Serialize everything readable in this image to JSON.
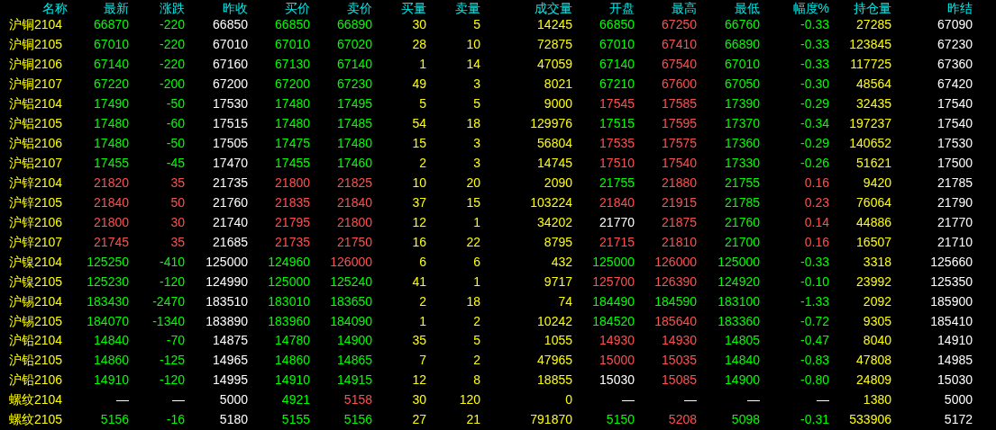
{
  "table": {
    "columns": [
      "名称",
      "最新",
      "涨跌",
      "昨收",
      "买价",
      "卖价",
      "买量",
      "卖量",
      "成交量",
      "开盘",
      "最高",
      "最低",
      "幅度%",
      "持仓量",
      "昨结"
    ],
    "rows": [
      {
        "cells": [
          {
            "text": "沪铜2104",
            "color": "#ffff00"
          },
          {
            "text": "66870",
            "color": "#00ff00"
          },
          {
            "text": "-220",
            "color": "#00ff00"
          },
          {
            "text": "66850",
            "color": "#ffffff"
          },
          {
            "text": "66850",
            "color": "#00ff00"
          },
          {
            "text": "66890",
            "color": "#00ff00"
          },
          {
            "text": "30",
            "color": "#ffff00"
          },
          {
            "text": "5",
            "color": "#ffff00"
          },
          {
            "text": "14245",
            "color": "#ffff00"
          },
          {
            "text": "66850",
            "color": "#00ff00"
          },
          {
            "text": "67250",
            "color": "#ff5050"
          },
          {
            "text": "66760",
            "color": "#00ff00"
          },
          {
            "text": "-0.33",
            "color": "#00ff00"
          },
          {
            "text": "27285",
            "color": "#ffff00"
          },
          {
            "text": "67090",
            "color": "#ffffff"
          }
        ]
      },
      {
        "cells": [
          {
            "text": "沪铜2105",
            "color": "#ffff00"
          },
          {
            "text": "67010",
            "color": "#00ff00"
          },
          {
            "text": "-220",
            "color": "#00ff00"
          },
          {
            "text": "67010",
            "color": "#ffffff"
          },
          {
            "text": "67010",
            "color": "#00ff00"
          },
          {
            "text": "67020",
            "color": "#00ff00"
          },
          {
            "text": "28",
            "color": "#ffff00"
          },
          {
            "text": "10",
            "color": "#ffff00"
          },
          {
            "text": "72875",
            "color": "#ffff00"
          },
          {
            "text": "67010",
            "color": "#00ff00"
          },
          {
            "text": "67410",
            "color": "#ff5050"
          },
          {
            "text": "66890",
            "color": "#00ff00"
          },
          {
            "text": "-0.33",
            "color": "#00ff00"
          },
          {
            "text": "123845",
            "color": "#ffff00"
          },
          {
            "text": "67230",
            "color": "#ffffff"
          }
        ]
      },
      {
        "cells": [
          {
            "text": "沪铜2106",
            "color": "#ffff00"
          },
          {
            "text": "67140",
            "color": "#00ff00"
          },
          {
            "text": "-220",
            "color": "#00ff00"
          },
          {
            "text": "67160",
            "color": "#ffffff"
          },
          {
            "text": "67130",
            "color": "#00ff00"
          },
          {
            "text": "67140",
            "color": "#00ff00"
          },
          {
            "text": "1",
            "color": "#ffff00"
          },
          {
            "text": "14",
            "color": "#ffff00"
          },
          {
            "text": "47059",
            "color": "#ffff00"
          },
          {
            "text": "67140",
            "color": "#00ff00"
          },
          {
            "text": "67540",
            "color": "#ff5050"
          },
          {
            "text": "67010",
            "color": "#00ff00"
          },
          {
            "text": "-0.33",
            "color": "#00ff00"
          },
          {
            "text": "117725",
            "color": "#ffff00"
          },
          {
            "text": "67360",
            "color": "#ffffff"
          }
        ]
      },
      {
        "cells": [
          {
            "text": "沪铜2107",
            "color": "#ffff00"
          },
          {
            "text": "67220",
            "color": "#00ff00"
          },
          {
            "text": "-200",
            "color": "#00ff00"
          },
          {
            "text": "67200",
            "color": "#ffffff"
          },
          {
            "text": "67200",
            "color": "#00ff00"
          },
          {
            "text": "67230",
            "color": "#00ff00"
          },
          {
            "text": "49",
            "color": "#ffff00"
          },
          {
            "text": "3",
            "color": "#ffff00"
          },
          {
            "text": "8021",
            "color": "#ffff00"
          },
          {
            "text": "67210",
            "color": "#00ff00"
          },
          {
            "text": "67600",
            "color": "#ff5050"
          },
          {
            "text": "67050",
            "color": "#00ff00"
          },
          {
            "text": "-0.30",
            "color": "#00ff00"
          },
          {
            "text": "48564",
            "color": "#ffff00"
          },
          {
            "text": "67420",
            "color": "#ffffff"
          }
        ]
      },
      {
        "cells": [
          {
            "text": "沪铝2104",
            "color": "#ffff00"
          },
          {
            "text": "17490",
            "color": "#00ff00"
          },
          {
            "text": "-50",
            "color": "#00ff00"
          },
          {
            "text": "17530",
            "color": "#ffffff"
          },
          {
            "text": "17480",
            "color": "#00ff00"
          },
          {
            "text": "17495",
            "color": "#00ff00"
          },
          {
            "text": "5",
            "color": "#ffff00"
          },
          {
            "text": "5",
            "color": "#ffff00"
          },
          {
            "text": "9000",
            "color": "#ffff00"
          },
          {
            "text": "17545",
            "color": "#ff5050"
          },
          {
            "text": "17585",
            "color": "#ff5050"
          },
          {
            "text": "17390",
            "color": "#00ff00"
          },
          {
            "text": "-0.29",
            "color": "#00ff00"
          },
          {
            "text": "32435",
            "color": "#ffff00"
          },
          {
            "text": "17540",
            "color": "#ffffff"
          }
        ]
      },
      {
        "cells": [
          {
            "text": "沪铝2105",
            "color": "#ffff00"
          },
          {
            "text": "17480",
            "color": "#00ff00"
          },
          {
            "text": "-60",
            "color": "#00ff00"
          },
          {
            "text": "17515",
            "color": "#ffffff"
          },
          {
            "text": "17480",
            "color": "#00ff00"
          },
          {
            "text": "17485",
            "color": "#00ff00"
          },
          {
            "text": "54",
            "color": "#ffff00"
          },
          {
            "text": "18",
            "color": "#ffff00"
          },
          {
            "text": "129976",
            "color": "#ffff00"
          },
          {
            "text": "17515",
            "color": "#00ff00"
          },
          {
            "text": "17595",
            "color": "#ff5050"
          },
          {
            "text": "17370",
            "color": "#00ff00"
          },
          {
            "text": "-0.34",
            "color": "#00ff00"
          },
          {
            "text": "197237",
            "color": "#ffff00"
          },
          {
            "text": "17540",
            "color": "#ffffff"
          }
        ]
      },
      {
        "cells": [
          {
            "text": "沪铝2106",
            "color": "#ffff00"
          },
          {
            "text": "17480",
            "color": "#00ff00"
          },
          {
            "text": "-50",
            "color": "#00ff00"
          },
          {
            "text": "17505",
            "color": "#ffffff"
          },
          {
            "text": "17475",
            "color": "#00ff00"
          },
          {
            "text": "17480",
            "color": "#00ff00"
          },
          {
            "text": "15",
            "color": "#ffff00"
          },
          {
            "text": "3",
            "color": "#ffff00"
          },
          {
            "text": "56804",
            "color": "#ffff00"
          },
          {
            "text": "17535",
            "color": "#ff5050"
          },
          {
            "text": "17575",
            "color": "#ff5050"
          },
          {
            "text": "17360",
            "color": "#00ff00"
          },
          {
            "text": "-0.29",
            "color": "#00ff00"
          },
          {
            "text": "140652",
            "color": "#ffff00"
          },
          {
            "text": "17530",
            "color": "#ffffff"
          }
        ]
      },
      {
        "cells": [
          {
            "text": "沪铝2107",
            "color": "#ffff00"
          },
          {
            "text": "17455",
            "color": "#00ff00"
          },
          {
            "text": "-45",
            "color": "#00ff00"
          },
          {
            "text": "17470",
            "color": "#ffffff"
          },
          {
            "text": "17455",
            "color": "#00ff00"
          },
          {
            "text": "17460",
            "color": "#00ff00"
          },
          {
            "text": "2",
            "color": "#ffff00"
          },
          {
            "text": "3",
            "color": "#ffff00"
          },
          {
            "text": "14745",
            "color": "#ffff00"
          },
          {
            "text": "17510",
            "color": "#ff5050"
          },
          {
            "text": "17540",
            "color": "#ff5050"
          },
          {
            "text": "17330",
            "color": "#00ff00"
          },
          {
            "text": "-0.26",
            "color": "#00ff00"
          },
          {
            "text": "51621",
            "color": "#ffff00"
          },
          {
            "text": "17500",
            "color": "#ffffff"
          }
        ]
      },
      {
        "cells": [
          {
            "text": "沪锌2104",
            "color": "#ffff00"
          },
          {
            "text": "21820",
            "color": "#ff5050"
          },
          {
            "text": "35",
            "color": "#ff5050"
          },
          {
            "text": "21735",
            "color": "#ffffff"
          },
          {
            "text": "21800",
            "color": "#ff5050"
          },
          {
            "text": "21825",
            "color": "#ff5050"
          },
          {
            "text": "10",
            "color": "#ffff00"
          },
          {
            "text": "20",
            "color": "#ffff00"
          },
          {
            "text": "2090",
            "color": "#ffff00"
          },
          {
            "text": "21755",
            "color": "#00ff00"
          },
          {
            "text": "21880",
            "color": "#ff5050"
          },
          {
            "text": "21755",
            "color": "#00ff00"
          },
          {
            "text": "0.16",
            "color": "#ff5050"
          },
          {
            "text": "9420",
            "color": "#ffff00"
          },
          {
            "text": "21785",
            "color": "#ffffff"
          }
        ]
      },
      {
        "cells": [
          {
            "text": "沪锌2105",
            "color": "#ffff00"
          },
          {
            "text": "21840",
            "color": "#ff5050"
          },
          {
            "text": "50",
            "color": "#ff5050"
          },
          {
            "text": "21760",
            "color": "#ffffff"
          },
          {
            "text": "21835",
            "color": "#ff5050"
          },
          {
            "text": "21840",
            "color": "#ff5050"
          },
          {
            "text": "37",
            "color": "#ffff00"
          },
          {
            "text": "15",
            "color": "#ffff00"
          },
          {
            "text": "103224",
            "color": "#ffff00"
          },
          {
            "text": "21840",
            "color": "#ff5050"
          },
          {
            "text": "21915",
            "color": "#ff5050"
          },
          {
            "text": "21785",
            "color": "#00ff00"
          },
          {
            "text": "0.23",
            "color": "#ff5050"
          },
          {
            "text": "76064",
            "color": "#ffff00"
          },
          {
            "text": "21790",
            "color": "#ffffff"
          }
        ]
      },
      {
        "cells": [
          {
            "text": "沪锌2106",
            "color": "#ffff00"
          },
          {
            "text": "21800",
            "color": "#ff5050"
          },
          {
            "text": "30",
            "color": "#ff5050"
          },
          {
            "text": "21740",
            "color": "#ffffff"
          },
          {
            "text": "21795",
            "color": "#ff5050"
          },
          {
            "text": "21800",
            "color": "#ff5050"
          },
          {
            "text": "12",
            "color": "#ffff00"
          },
          {
            "text": "1",
            "color": "#ffff00"
          },
          {
            "text": "34202",
            "color": "#ffff00"
          },
          {
            "text": "21770",
            "color": "#ffffff"
          },
          {
            "text": "21875",
            "color": "#ff5050"
          },
          {
            "text": "21760",
            "color": "#00ff00"
          },
          {
            "text": "0.14",
            "color": "#ff5050"
          },
          {
            "text": "44886",
            "color": "#ffff00"
          },
          {
            "text": "21770",
            "color": "#ffffff"
          }
        ]
      },
      {
        "cells": [
          {
            "text": "沪锌2107",
            "color": "#ffff00"
          },
          {
            "text": "21745",
            "color": "#ff5050"
          },
          {
            "text": "35",
            "color": "#ff5050"
          },
          {
            "text": "21685",
            "color": "#ffffff"
          },
          {
            "text": "21735",
            "color": "#ff5050"
          },
          {
            "text": "21750",
            "color": "#ff5050"
          },
          {
            "text": "16",
            "color": "#ffff00"
          },
          {
            "text": "22",
            "color": "#ffff00"
          },
          {
            "text": "8795",
            "color": "#ffff00"
          },
          {
            "text": "21715",
            "color": "#ff5050"
          },
          {
            "text": "21810",
            "color": "#ff5050"
          },
          {
            "text": "21700",
            "color": "#00ff00"
          },
          {
            "text": "0.16",
            "color": "#ff5050"
          },
          {
            "text": "16507",
            "color": "#ffff00"
          },
          {
            "text": "21710",
            "color": "#ffffff"
          }
        ]
      },
      {
        "cells": [
          {
            "text": "沪镍2104",
            "color": "#ffff00"
          },
          {
            "text": "125250",
            "color": "#00ff00"
          },
          {
            "text": "-410",
            "color": "#00ff00"
          },
          {
            "text": "125000",
            "color": "#ffffff"
          },
          {
            "text": "124960",
            "color": "#00ff00"
          },
          {
            "text": "126000",
            "color": "#ff5050"
          },
          {
            "text": "6",
            "color": "#ffff00"
          },
          {
            "text": "6",
            "color": "#ffff00"
          },
          {
            "text": "432",
            "color": "#ffff00"
          },
          {
            "text": "125000",
            "color": "#00ff00"
          },
          {
            "text": "126000",
            "color": "#ff5050"
          },
          {
            "text": "125000",
            "color": "#00ff00"
          },
          {
            "text": "-0.33",
            "color": "#00ff00"
          },
          {
            "text": "3318",
            "color": "#ffff00"
          },
          {
            "text": "125660",
            "color": "#ffffff"
          }
        ]
      },
      {
        "cells": [
          {
            "text": "沪镍2105",
            "color": "#ffff00"
          },
          {
            "text": "125230",
            "color": "#00ff00"
          },
          {
            "text": "-120",
            "color": "#00ff00"
          },
          {
            "text": "124990",
            "color": "#ffffff"
          },
          {
            "text": "125000",
            "color": "#00ff00"
          },
          {
            "text": "125240",
            "color": "#00ff00"
          },
          {
            "text": "41",
            "color": "#ffff00"
          },
          {
            "text": "1",
            "color": "#ffff00"
          },
          {
            "text": "9717",
            "color": "#ffff00"
          },
          {
            "text": "125700",
            "color": "#ff5050"
          },
          {
            "text": "126390",
            "color": "#ff5050"
          },
          {
            "text": "124920",
            "color": "#00ff00"
          },
          {
            "text": "-0.10",
            "color": "#00ff00"
          },
          {
            "text": "23992",
            "color": "#ffff00"
          },
          {
            "text": "125350",
            "color": "#ffffff"
          }
        ]
      },
      {
        "cells": [
          {
            "text": "沪锡2104",
            "color": "#ffff00"
          },
          {
            "text": "183430",
            "color": "#00ff00"
          },
          {
            "text": "-2470",
            "color": "#00ff00"
          },
          {
            "text": "183510",
            "color": "#ffffff"
          },
          {
            "text": "183010",
            "color": "#00ff00"
          },
          {
            "text": "183650",
            "color": "#00ff00"
          },
          {
            "text": "2",
            "color": "#ffff00"
          },
          {
            "text": "18",
            "color": "#ffff00"
          },
          {
            "text": "74",
            "color": "#ffff00"
          },
          {
            "text": "184490",
            "color": "#00ff00"
          },
          {
            "text": "184590",
            "color": "#00ff00"
          },
          {
            "text": "183100",
            "color": "#00ff00"
          },
          {
            "text": "-1.33",
            "color": "#00ff00"
          },
          {
            "text": "2092",
            "color": "#ffff00"
          },
          {
            "text": "185900",
            "color": "#ffffff"
          }
        ]
      },
      {
        "cells": [
          {
            "text": "沪锡2105",
            "color": "#ffff00"
          },
          {
            "text": "184070",
            "color": "#00ff00"
          },
          {
            "text": "-1340",
            "color": "#00ff00"
          },
          {
            "text": "183890",
            "color": "#ffffff"
          },
          {
            "text": "183960",
            "color": "#00ff00"
          },
          {
            "text": "184090",
            "color": "#00ff00"
          },
          {
            "text": "1",
            "color": "#ffff00"
          },
          {
            "text": "2",
            "color": "#ffff00"
          },
          {
            "text": "10242",
            "color": "#ffff00"
          },
          {
            "text": "184520",
            "color": "#00ff00"
          },
          {
            "text": "185640",
            "color": "#ff5050"
          },
          {
            "text": "183360",
            "color": "#00ff00"
          },
          {
            "text": "-0.72",
            "color": "#00ff00"
          },
          {
            "text": "9305",
            "color": "#ffff00"
          },
          {
            "text": "185410",
            "color": "#ffffff"
          }
        ]
      },
      {
        "cells": [
          {
            "text": "沪铅2104",
            "color": "#ffff00"
          },
          {
            "text": "14840",
            "color": "#00ff00"
          },
          {
            "text": "-70",
            "color": "#00ff00"
          },
          {
            "text": "14875",
            "color": "#ffffff"
          },
          {
            "text": "14780",
            "color": "#00ff00"
          },
          {
            "text": "14900",
            "color": "#00ff00"
          },
          {
            "text": "35",
            "color": "#ffff00"
          },
          {
            "text": "5",
            "color": "#ffff00"
          },
          {
            "text": "1055",
            "color": "#ffff00"
          },
          {
            "text": "14930",
            "color": "#ff5050"
          },
          {
            "text": "14930",
            "color": "#ff5050"
          },
          {
            "text": "14805",
            "color": "#00ff00"
          },
          {
            "text": "-0.47",
            "color": "#00ff00"
          },
          {
            "text": "8040",
            "color": "#ffff00"
          },
          {
            "text": "14910",
            "color": "#ffffff"
          }
        ]
      },
      {
        "cells": [
          {
            "text": "沪铅2105",
            "color": "#ffff00"
          },
          {
            "text": "14860",
            "color": "#00ff00"
          },
          {
            "text": "-125",
            "color": "#00ff00"
          },
          {
            "text": "14965",
            "color": "#ffffff"
          },
          {
            "text": "14860",
            "color": "#00ff00"
          },
          {
            "text": "14865",
            "color": "#00ff00"
          },
          {
            "text": "7",
            "color": "#ffff00"
          },
          {
            "text": "2",
            "color": "#ffff00"
          },
          {
            "text": "47965",
            "color": "#ffff00"
          },
          {
            "text": "15000",
            "color": "#ff5050"
          },
          {
            "text": "15035",
            "color": "#ff5050"
          },
          {
            "text": "14840",
            "color": "#00ff00"
          },
          {
            "text": "-0.83",
            "color": "#00ff00"
          },
          {
            "text": "47808",
            "color": "#ffff00"
          },
          {
            "text": "14985",
            "color": "#ffffff"
          }
        ]
      },
      {
        "cells": [
          {
            "text": "沪铅2106",
            "color": "#ffff00"
          },
          {
            "text": "14910",
            "color": "#00ff00"
          },
          {
            "text": "-120",
            "color": "#00ff00"
          },
          {
            "text": "14995",
            "color": "#ffffff"
          },
          {
            "text": "14910",
            "color": "#00ff00"
          },
          {
            "text": "14915",
            "color": "#00ff00"
          },
          {
            "text": "12",
            "color": "#ffff00"
          },
          {
            "text": "8",
            "color": "#ffff00"
          },
          {
            "text": "18855",
            "color": "#ffff00"
          },
          {
            "text": "15030",
            "color": "#ffffff"
          },
          {
            "text": "15085",
            "color": "#ff5050"
          },
          {
            "text": "14900",
            "color": "#00ff00"
          },
          {
            "text": "-0.80",
            "color": "#00ff00"
          },
          {
            "text": "24809",
            "color": "#ffff00"
          },
          {
            "text": "15030",
            "color": "#ffffff"
          }
        ]
      },
      {
        "cells": [
          {
            "text": "螺纹2104",
            "color": "#ffff00"
          },
          {
            "text": "—",
            "color": "#ffffff"
          },
          {
            "text": "—",
            "color": "#ffffff"
          },
          {
            "text": "5000",
            "color": "#ffffff"
          },
          {
            "text": "4921",
            "color": "#00ff00"
          },
          {
            "text": "5158",
            "color": "#ff5050"
          },
          {
            "text": "30",
            "color": "#ffff00"
          },
          {
            "text": "120",
            "color": "#ffff00"
          },
          {
            "text": "0",
            "color": "#ffff00"
          },
          {
            "text": "—",
            "color": "#ffffff"
          },
          {
            "text": "—",
            "color": "#ffffff"
          },
          {
            "text": "—",
            "color": "#ffffff"
          },
          {
            "text": "—",
            "color": "#ffffff"
          },
          {
            "text": "1380",
            "color": "#ffff00"
          },
          {
            "text": "5000",
            "color": "#ffffff"
          }
        ]
      },
      {
        "cells": [
          {
            "text": "螺纹2105",
            "color": "#ffff00"
          },
          {
            "text": "5156",
            "color": "#00ff00"
          },
          {
            "text": "-16",
            "color": "#00ff00"
          },
          {
            "text": "5180",
            "color": "#ffffff"
          },
          {
            "text": "5155",
            "color": "#00ff00"
          },
          {
            "text": "5156",
            "color": "#00ff00"
          },
          {
            "text": "27",
            "color": "#ffff00"
          },
          {
            "text": "21",
            "color": "#ffff00"
          },
          {
            "text": "791870",
            "color": "#ffff00"
          },
          {
            "text": "5150",
            "color": "#00ff00"
          },
          {
            "text": "5208",
            "color": "#ff5050"
          },
          {
            "text": "5098",
            "color": "#00ff00"
          },
          {
            "text": "-0.31",
            "color": "#00ff00"
          },
          {
            "text": "533906",
            "color": "#ffff00"
          },
          {
            "text": "5172",
            "color": "#ffffff"
          }
        ]
      }
    ]
  }
}
